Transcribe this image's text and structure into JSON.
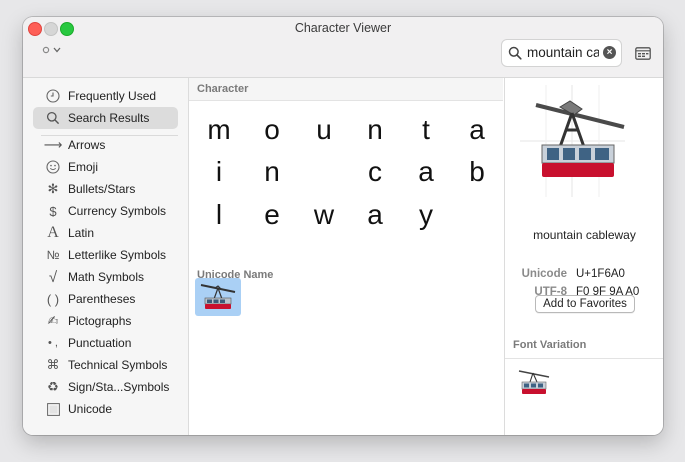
{
  "window": {
    "title": "Character Viewer"
  },
  "search": {
    "value": "mountain cab"
  },
  "sidebar": {
    "items": [
      {
        "label": "Frequently Used",
        "icon": "clock-icon"
      },
      {
        "label": "Search Results",
        "icon": "search-icon"
      },
      {
        "label": "Arrows",
        "icon": "arrow-icon"
      },
      {
        "label": "Emoji",
        "icon": "smiley-icon"
      },
      {
        "label": "Bullets/Stars",
        "icon": "snowflake-icon"
      },
      {
        "label": "Currency Symbols",
        "icon": "dollar-icon"
      },
      {
        "label": "Latin",
        "icon": "latin-a-icon"
      },
      {
        "label": "Letterlike Symbols",
        "icon": "numero-icon"
      },
      {
        "label": "Math Symbols",
        "icon": "sqrt-icon"
      },
      {
        "label": "Parentheses",
        "icon": "parentheses-icon"
      },
      {
        "label": "Pictographs",
        "icon": "pictograph-icon"
      },
      {
        "label": "Punctuation",
        "icon": "punctuation-icon"
      },
      {
        "label": "Technical Symbols",
        "icon": "command-icon"
      },
      {
        "label": "Sign/Sta...Symbols",
        "icon": "recycle-icon"
      },
      {
        "label": "Unicode",
        "icon": "unicode-icon"
      }
    ]
  },
  "middle": {
    "character_header": "Character",
    "characters": [
      "m",
      "o",
      "u",
      "n",
      "t",
      "a",
      "i",
      "n",
      "c",
      "a",
      "b",
      "l",
      "e",
      "w",
      "a",
      "y"
    ],
    "unicode_header": "Unicode Name"
  },
  "right": {
    "name": "mountain cableway",
    "unicode_label": "Unicode",
    "unicode_value": "U+1F6A0",
    "utf8_label": "UTF-8",
    "utf8_value": "F0 9F 9A A0",
    "favorites_button": "Add to Favorites",
    "font_variation_header": "Font Variation"
  },
  "colors": {
    "selection": "#aad0f5",
    "sidebar_selected": "#dcdcdc",
    "cable_car_red": "#c8102e"
  }
}
